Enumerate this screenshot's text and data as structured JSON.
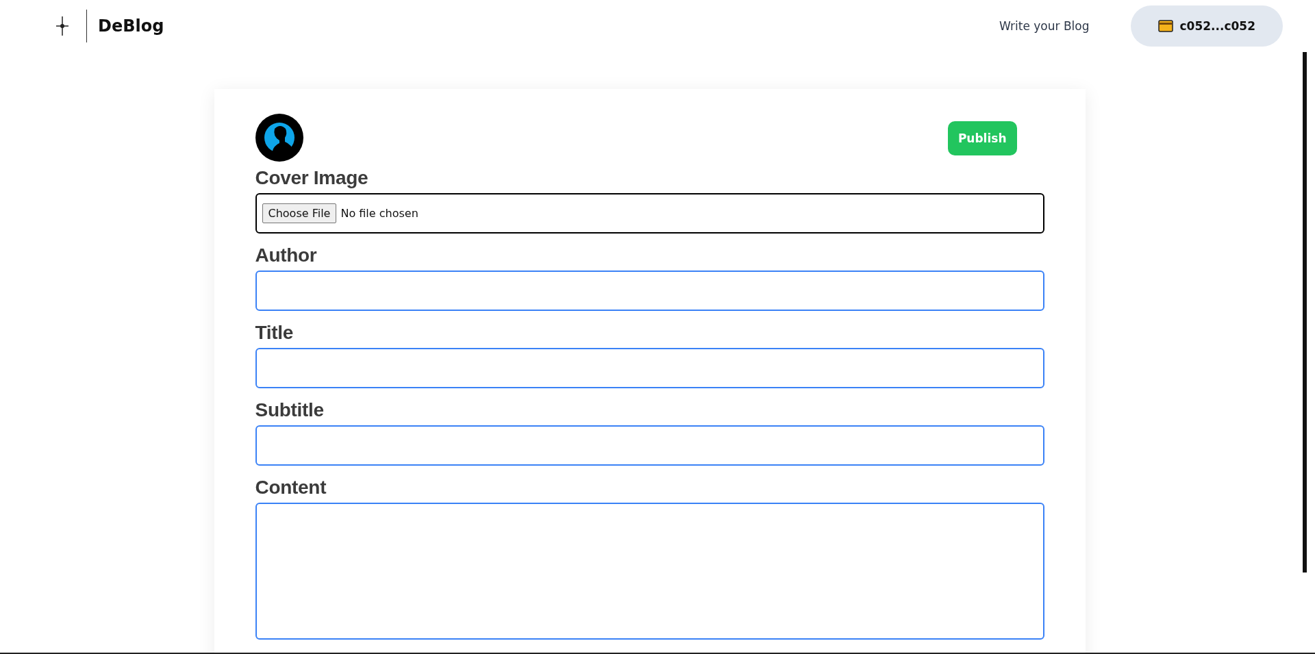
{
  "header": {
    "brand": "DeBlog",
    "nav_link": "Write your Blog",
    "wallet": "c052...c052"
  },
  "editor": {
    "publish_button": "Publish",
    "fields": [
      {
        "kind": "file",
        "label": "Cover Image",
        "button": "Choose File",
        "status": "No file chosen"
      },
      {
        "kind": "text",
        "label": "Author"
      },
      {
        "kind": "text",
        "label": "Title"
      },
      {
        "kind": "text",
        "label": "Subtitle"
      },
      {
        "kind": "textarea",
        "label": "Content"
      }
    ]
  }
}
